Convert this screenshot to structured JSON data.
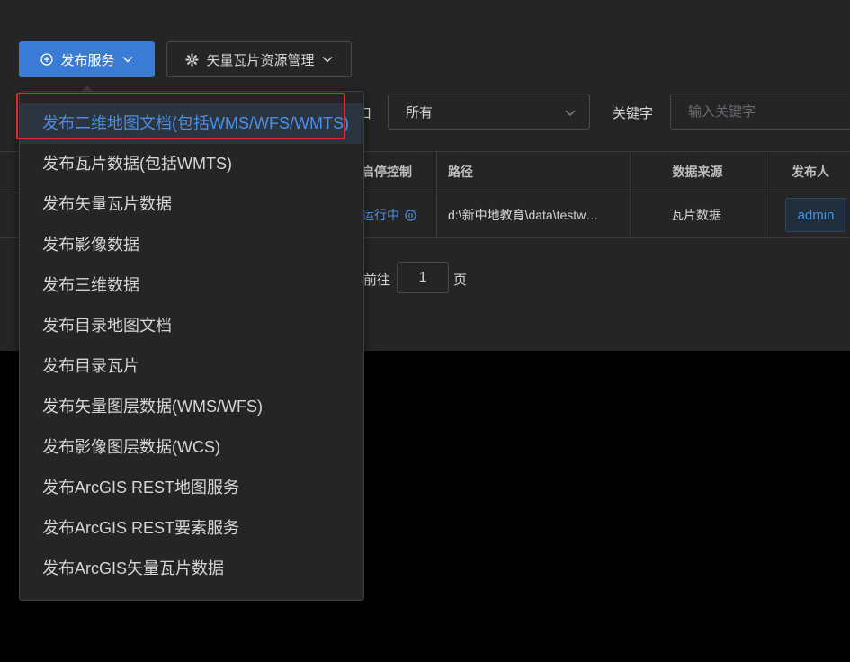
{
  "toolbar": {
    "publish_label": "发布服务",
    "vector_tile_label": "矢量瓦片资源管理"
  },
  "filters": {
    "port_label_fragment": "口",
    "select_value": "所有",
    "keyword_label": "关键字",
    "keyword_placeholder": "输入关键字"
  },
  "table": {
    "headers": [
      "启停控制",
      "路径",
      "数据来源",
      "发布人"
    ],
    "row": {
      "status": "运行中",
      "path": "d:\\新中地教育\\data\\testw…",
      "source": "瓦片数据",
      "publisher": "admin"
    }
  },
  "pager": {
    "goto_label": "前往",
    "page_value": "1",
    "page_suffix": "页"
  },
  "menu": {
    "items": [
      "发布二维地图文档(包括WMS/WFS/WMTS)",
      "发布瓦片数据(包括WMTS)",
      "发布矢量瓦片数据",
      "发布影像数据",
      "发布三维数据",
      "发布目录地图文档",
      "发布目录瓦片",
      "发布矢量图层数据(WMS/WFS)",
      "发布影像图层数据(WCS)",
      "发布ArcGIS REST地图服务",
      "发布ArcGIS REST要素服务",
      "发布ArcGIS矢量瓦片数据"
    ],
    "active_index": 0
  },
  "colors": {
    "accent": "#3a7bd5",
    "link": "#4a90e2",
    "highlight": "#e0282e",
    "panel_bg": "#252526"
  }
}
